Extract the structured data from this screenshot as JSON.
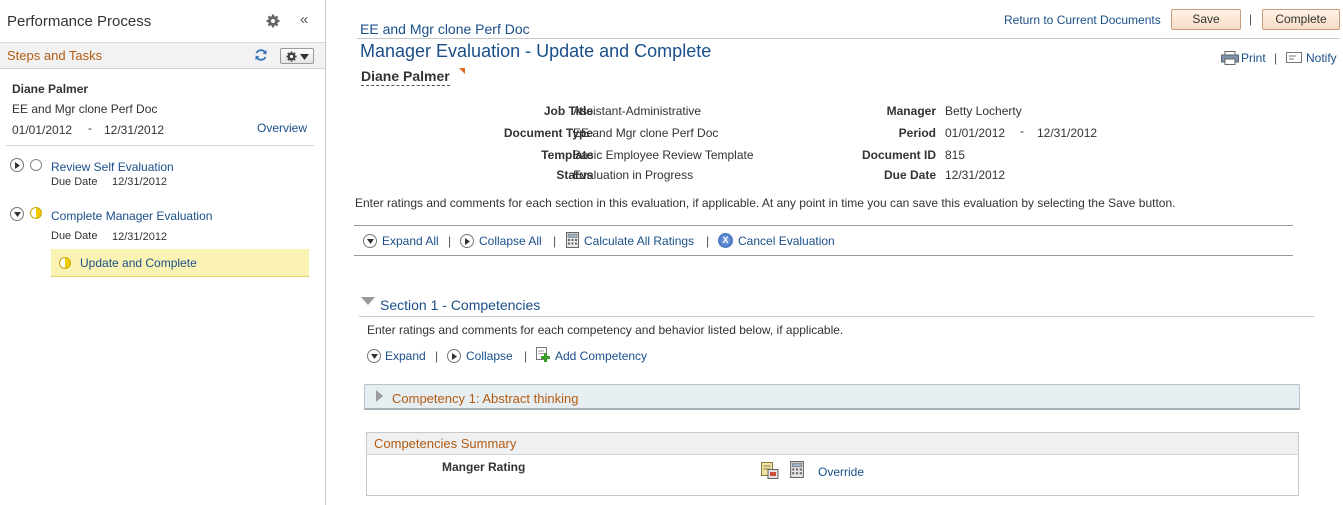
{
  "left_panel": {
    "title": "Performance Process",
    "steps_title": "Steps and Tasks",
    "employee": {
      "name": "Diane Palmer",
      "document": "EE and Mgr clone Perf Doc",
      "period_start": "01/01/2012",
      "period_sep": "-",
      "period_end": "12/31/2012",
      "overview_link": "Overview"
    },
    "steps": [
      {
        "label": "Review Self Evaluation",
        "due_label": "Due Date",
        "due_date": "12/31/2012",
        "status": "not-started"
      },
      {
        "label": "Complete Manager Evaluation",
        "due_label": "Due Date",
        "due_date": "12/31/2012",
        "status": "in-progress"
      }
    ],
    "current_task": "Update and Complete"
  },
  "header": {
    "doc_title": "EE and Mgr clone Perf Doc",
    "return_link": "Return to Current Documents",
    "save_label": "Save",
    "complete_label": "Complete",
    "pipe": "|",
    "page_title": "Manager Evaluation - Update and Complete",
    "employee_name": "Diane Palmer",
    "print_label": "Print",
    "notify_label": "Notify"
  },
  "details": {
    "job_title_label": "Job Title",
    "job_title": "Assistant-Administrative",
    "doc_type_label": "Document Type",
    "doc_type": "EE and Mgr clone Perf Doc",
    "template_label": "Template",
    "template": "Basic Employee Review Template",
    "status_label": "Status",
    "status": "Evaluation in Progress",
    "manager_label": "Manager",
    "manager": "Betty Locherty",
    "period_label": "Period",
    "period_start": "01/01/2012",
    "period_sep": "-",
    "period_end": "12/31/2012",
    "doc_id_label": "Document ID",
    "doc_id": "815",
    "due_label": "Due Date",
    "due": "12/31/2012"
  },
  "instructions": "Enter ratings and comments for each section in this evaluation, if applicable. At any point in time you can save this evaluation by selecting the Save button.",
  "toolbar": {
    "expand_all": "Expand All",
    "collapse_all": "Collapse All",
    "calculate": "Calculate All Ratings",
    "cancel": "Cancel Evaluation"
  },
  "section1": {
    "title": "Section 1 - Competencies",
    "instructions": "Enter ratings and comments for each competency and behavior listed below, if applicable.",
    "expand": "Expand",
    "collapse": "Collapse",
    "add": "Add Competency",
    "competency_title": "Competency 1: Abstract thinking",
    "summary_title": "Competencies Summary",
    "rating_label": "Manger Rating",
    "override_link": "Override"
  },
  "colors": {
    "link": "#1a4f8a",
    "accent_orange": "#b35b12",
    "current_task_bg": "#fbf3b3"
  }
}
